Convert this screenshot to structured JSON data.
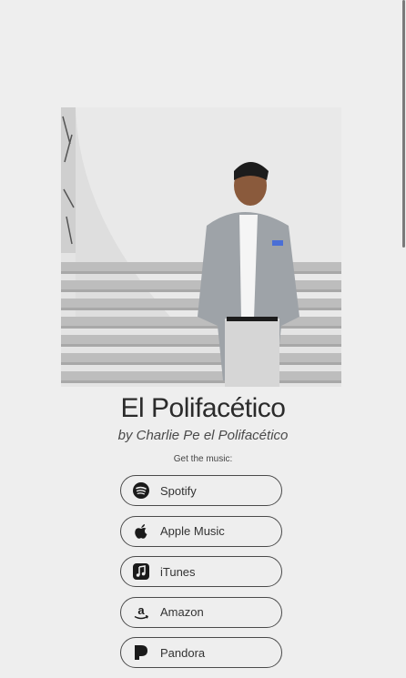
{
  "album": {
    "title": "El Polifacético",
    "artist_line": "by Charlie Pe el Polifacético"
  },
  "get_music_label": "Get the music:",
  "services": [
    {
      "label": "Spotify",
      "icon": "spotify-icon"
    },
    {
      "label": "Apple Music",
      "icon": "apple-icon"
    },
    {
      "label": "iTunes",
      "icon": "itunes-icon"
    },
    {
      "label": "Amazon",
      "icon": "amazon-icon"
    },
    {
      "label": "Pandora",
      "icon": "pandora-icon"
    }
  ],
  "colors": {
    "background": "#eeeeee",
    "button_border": "#4a4a4a",
    "text": "#2b2b2b"
  }
}
